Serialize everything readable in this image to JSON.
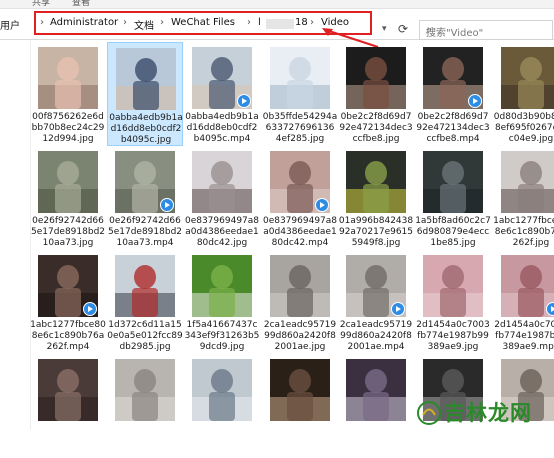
{
  "ribbon": {
    "tabs": [
      "共享",
      "查看"
    ]
  },
  "address": {
    "left_crumb": "用户",
    "crumbs": [
      "Administrator",
      "文档",
      "WeChat Files",
      "l",
      "18",
      "Video"
    ]
  },
  "search": {
    "placeholder": "搜索\"Video\""
  },
  "watermark": {
    "text": "吉林龙网"
  },
  "files": [
    {
      "name": "00f8756262e6dbb70b8ec24c2912d994.jpg",
      "type": "image",
      "selected": false,
      "colors": [
        "#c8b4a4",
        "#e8c0b0",
        "#8a6f62"
      ]
    },
    {
      "name": "0abba4edb9b1ad16dd8eb0cdf2b4095c.jpg",
      "type": "image",
      "selected": true,
      "colors": [
        "#b8c8d8",
        "#3a4b6a",
        "#d9c0a8"
      ]
    },
    {
      "name": "0abba4edb9b1ad16dd8eb0cdf2b4095c.mp4",
      "type": "video",
      "selected": false,
      "colors": [
        "#c5d0d8",
        "#4a5870",
        "#d8c4b0"
      ]
    },
    {
      "name": "0b35ffde54294a633727696136 4ef285.jpg",
      "type": "image",
      "selected": false,
      "colors": [
        "#e8eef4",
        "#c9d6e2",
        "#9fb2c6"
      ]
    },
    {
      "name": "0be2c2f8d69d792e472134dec3ccfbe8.jpg",
      "type": "image",
      "selected": false,
      "colors": [
        "#1c1c1c",
        "#7a4f40",
        "#bfa08e"
      ]
    },
    {
      "name": "0be2c2f8d69d792e472134dec3ccfbe8.mp4",
      "type": "video",
      "selected": false,
      "colors": [
        "#222222",
        "#8a6555",
        "#c9aa98"
      ]
    },
    {
      "name": "0d80d3b90b8968ef695f0267e0fc04e9.jpg",
      "type": "image",
      "selected": false,
      "colors": [
        "#6a5a3a",
        "#9a8a5a",
        "#3a3020"
      ]
    },
    {
      "name": "0e26f92742d665e17de8918bd210aa73.jpg",
      "type": "image",
      "selected": false,
      "colors": [
        "#7a8470",
        "#a8ac98",
        "#4a5040"
      ]
    },
    {
      "name": "0e26f92742d665e17de8918bd210aa73.mp4",
      "type": "video",
      "selected": false,
      "colors": [
        "#888e80",
        "#b0b4a4",
        "#555a4e"
      ]
    },
    {
      "name": "0e837969497a8a0d4386eedae180dc42.jpg",
      "type": "image",
      "selected": false,
      "colors": [
        "#d8d4d8",
        "#9a9090",
        "#5a4848"
      ]
    },
    {
      "name": "0e837969497a8a0d4386eedae180dc42.mp4",
      "type": "video",
      "selected": false,
      "colors": [
        "#c0a098",
        "#7a5a56",
        "#e0d0cc"
      ]
    },
    {
      "name": "01a996b842438 92a70217e96155949f8.jpg",
      "type": "image",
      "selected": false,
      "colors": [
        "#2a3028",
        "#8aa048",
        "#d0d040"
      ]
    },
    {
      "name": "1a5bf8ad60c2c76d980879e4ecc1be85.jpg",
      "type": "image",
      "selected": false,
      "colors": [
        "#303838",
        "#6a7478",
        "#1a2022"
      ]
    },
    {
      "name": "1abc1277fbce808e6c1c890b76a262f.jpg",
      "type": "image",
      "selected": false,
      "colors": [
        "#d0cac8",
        "#8a7e7c",
        "#5a4e4c"
      ]
    },
    {
      "name": "1abc1277fbce808e6c1c890b76a262f.mp4",
      "type": "video",
      "selected": false,
      "colors": [
        "#3a2c28",
        "#8a6a5c",
        "#1a1412"
      ]
    },
    {
      "name": "1d372c6d11a150e0a5e012fcc89db2985.jpg",
      "type": "image",
      "selected": false,
      "colors": [
        "#c8d0d8",
        "#b02a2a",
        "#3a3e48"
      ]
    },
    {
      "name": "1f5a41667437c343ef9f31263b59dcd9.jpg",
      "type": "image",
      "selected": false,
      "colors": [
        "#4a8a2a",
        "#7ab048",
        "#e8e8e0"
      ]
    },
    {
      "name": "2ca1eadc9571999d860a2420f82001ae.jpg",
      "type": "image",
      "selected": false,
      "colors": [
        "#a8a4a0",
        "#6a6460",
        "#d0ccc8"
      ]
    },
    {
      "name": "2ca1eadc9571999d860a2420f82001ae.mp4",
      "type": "video",
      "selected": false,
      "colors": [
        "#b0aca8",
        "#726c68",
        "#d8d4d0"
      ]
    },
    {
      "name": "2d1454a0c7003fb774e1987b99389ae9.jpg",
      "type": "image",
      "selected": false,
      "colors": [
        "#d8a8b0",
        "#a06870",
        "#e8d0d4"
      ]
    },
    {
      "name": "2d1454a0c7003fb774e1987b99389ae9.mp4",
      "type": "video",
      "selected": false,
      "colors": [
        "#c898a0",
        "#985860",
        "#e0c4c8"
      ]
    },
    {
      "name": "",
      "type": "image",
      "selected": false,
      "colors": [
        "#4a3a38",
        "#8a7068",
        "#2a1e1c"
      ]
    },
    {
      "name": "",
      "type": "image",
      "selected": false,
      "colors": [
        "#b8b4b0",
        "#8a8480",
        "#e0dcd8"
      ]
    },
    {
      "name": "",
      "type": "image",
      "selected": false,
      "colors": [
        "#c0c8d0",
        "#6a7888",
        "#e8ecf0"
      ]
    },
    {
      "name": "",
      "type": "image",
      "selected": false,
      "colors": [
        "#2a2018",
        "#6a5040",
        "#c8a888"
      ]
    },
    {
      "name": "",
      "type": "image",
      "selected": false,
      "colors": [
        "#3a3040",
        "#7a6a88",
        "#d0c8d8"
      ]
    },
    {
      "name": "",
      "type": "image",
      "selected": false,
      "colors": [
        "#2a2a2a",
        "#5a5a5a",
        "#a8a8a8"
      ]
    },
    {
      "name": "",
      "type": "image",
      "selected": false,
      "colors": [
        "#b8b0a8",
        "#6a6058",
        "#e0d8d0"
      ]
    }
  ]
}
